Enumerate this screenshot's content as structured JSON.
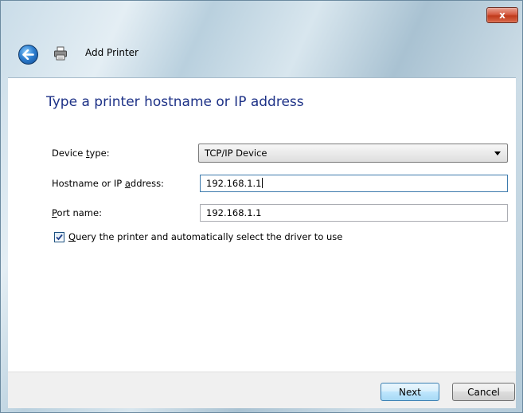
{
  "window": {
    "title": "Add Printer",
    "close_glyph": "x"
  },
  "page": {
    "heading": "Type a printer hostname or IP address"
  },
  "form": {
    "device_type": {
      "label_pre": "Device ",
      "label_key": "t",
      "label_post": "ype:",
      "value": "TCP/IP Device"
    },
    "hostname": {
      "label_pre": "Hostname or IP ",
      "label_key": "a",
      "label_post": "ddress:",
      "value": "192.168.1.1"
    },
    "port_name": {
      "label_pre": "",
      "label_key": "P",
      "label_post": "ort name:",
      "value": "192.168.1.1"
    },
    "query_driver": {
      "checked": true,
      "label_key": "Q",
      "label_post": "uery the printer and automatically select the driver to use"
    }
  },
  "buttons": {
    "next": "Next",
    "cancel": "Cancel"
  },
  "icons": {
    "back": "back-arrow-icon",
    "printer": "printer-icon",
    "close": "close-icon",
    "dropdown": "chevron-down-icon",
    "check": "checkmark-icon"
  }
}
